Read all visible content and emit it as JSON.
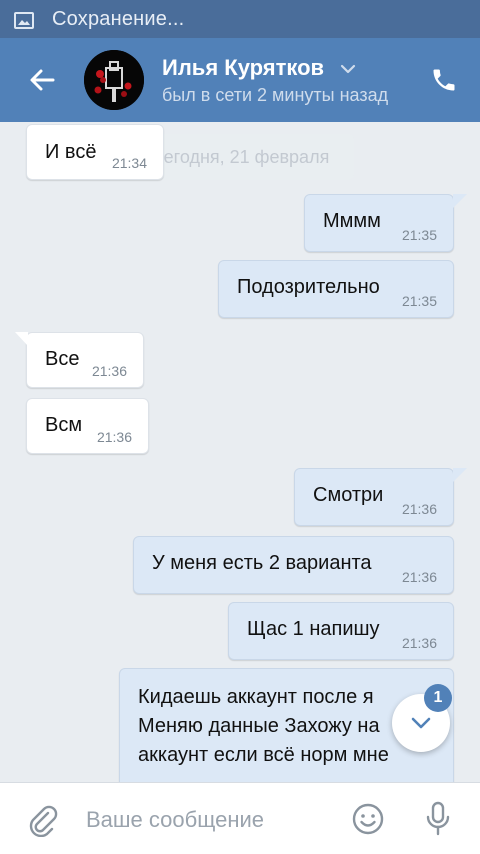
{
  "status_bar": {
    "text": "Сохранение...",
    "icon": "image-icon"
  },
  "header": {
    "name": "Илья Курятков",
    "status": "был в сети 2 минуты назад",
    "back_icon": "arrow-left-icon",
    "call_icon": "phone-icon",
    "dropdown_icon": "chevron-down-icon"
  },
  "chat": {
    "date_label": "Сегодня, 21 февраля",
    "messages": [
      {
        "dir": "in",
        "text": "И всё",
        "time": "21:34"
      },
      {
        "dir": "out",
        "text": "Мммм",
        "time": "21:35"
      },
      {
        "dir": "out",
        "text": "Подозрительно",
        "time": "21:35"
      },
      {
        "dir": "in",
        "text": "Все",
        "time": "21:36"
      },
      {
        "dir": "in",
        "text": "Всм",
        "time": "21:36"
      },
      {
        "dir": "out",
        "text": "Смотри",
        "time": "21:36"
      },
      {
        "dir": "out",
        "text": "У меня есть 2 варианта",
        "time": "21:36"
      },
      {
        "dir": "out",
        "text": "Щас 1 напишу",
        "time": "21:36"
      },
      {
        "dir": "out",
        "text": "Кидаешь аккаунт после я\nМеняю данные Захожу на\nаккаунт если всё норм мне",
        "time": ""
      }
    ]
  },
  "scroll_button": {
    "badge": "1",
    "icon": "chevron-down-icon"
  },
  "composer": {
    "placeholder": "Ваше сообщение",
    "value": "",
    "attach_icon": "paperclip-icon",
    "emoji_icon": "smiley-icon",
    "mic_icon": "microphone-icon"
  },
  "colors": {
    "header": "#5181b8",
    "status_bar": "#4a6d9a",
    "background": "#e9edf1",
    "outgoing_bubble": "#dce8f6",
    "incoming_bubble": "#ffffff",
    "accent": "#5181b8"
  }
}
